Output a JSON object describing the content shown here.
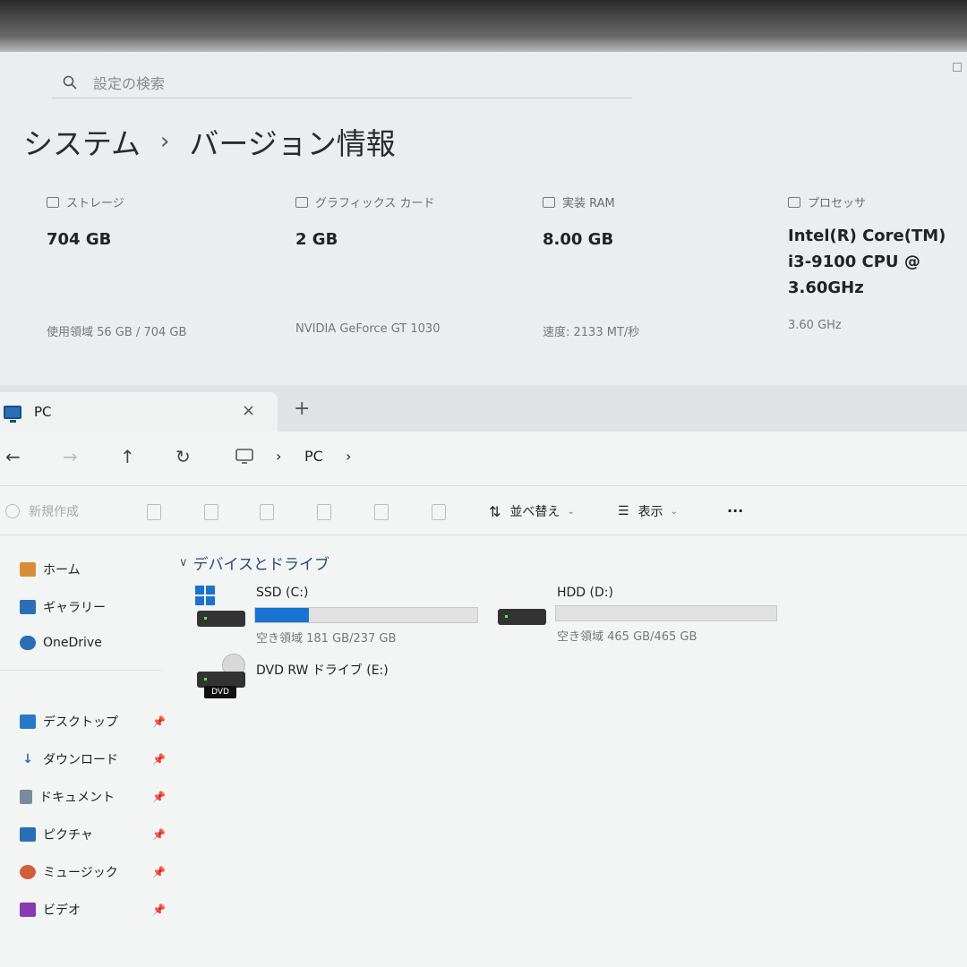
{
  "settings": {
    "search_placeholder": "設定の検索",
    "breadcrumb": {
      "parent": "システム",
      "separator": "›",
      "current": "バージョン情報"
    },
    "specs": [
      {
        "label": "ストレージ",
        "value": "704 GB",
        "sub": "使用領域 56 GB / 704 GB",
        "icon": "storage-icon"
      },
      {
        "label": "グラフィックス カード",
        "value": "2 GB",
        "sub": "NVIDIA GeForce GT 1030",
        "icon": "graphics-card-icon"
      },
      {
        "label": "実装 RAM",
        "value": "8.00 GB",
        "sub": "速度: 2133 MT/秒",
        "icon": "ram-icon"
      },
      {
        "label": "プロセッサ",
        "value": "Intel(R) Core(TM) i3-9100 CPU @ 3.60GHz",
        "sub": "3.60 GHz",
        "icon": "processor-icon"
      }
    ]
  },
  "explorer": {
    "tab": {
      "title": "PC",
      "close": "×",
      "new": "+"
    },
    "nav": {
      "back": "←",
      "forward": "→",
      "up": "↑",
      "refresh": "↻",
      "crumb_sep": "›",
      "crumb": "PC",
      "crumb_end": "›"
    },
    "commands": {
      "new": "新規作成",
      "sort": "並べ替え",
      "view": "表示",
      "more": "···"
    },
    "sidebar": [
      {
        "label": "ホーム",
        "icon": "home-icon",
        "pinned": false
      },
      {
        "label": "ギャラリー",
        "icon": "gallery-icon",
        "pinned": false
      },
      {
        "label": "OneDrive",
        "icon": "onedrive-icon",
        "pinned": false
      },
      {
        "label": "デスクトップ",
        "icon": "desktop-icon",
        "pinned": true
      },
      {
        "label": "ダウンロード",
        "icon": "download-icon",
        "pinned": true
      },
      {
        "label": "ドキュメント",
        "icon": "documents-icon",
        "pinned": true
      },
      {
        "label": "ピクチャ",
        "icon": "pictures-icon",
        "pinned": true
      },
      {
        "label": "ミュージック",
        "icon": "music-icon",
        "pinned": true
      },
      {
        "label": "ビデオ",
        "icon": "videos-icon",
        "pinned": true
      }
    ],
    "group_header": "デバイスとドライブ",
    "drives": {
      "c": {
        "name": "SSD (C:)",
        "free": "空き領域 181 GB/237 GB",
        "used_fraction": 0.24
      },
      "d": {
        "name": "HDD (D:)",
        "free": "空き領域 465 GB/465 GB",
        "used_fraction": 0.0
      },
      "e": {
        "name": "DVD RW ドライブ (E:)",
        "badge": "DVD"
      }
    },
    "colors": {
      "accent": "#1a73d0"
    }
  }
}
